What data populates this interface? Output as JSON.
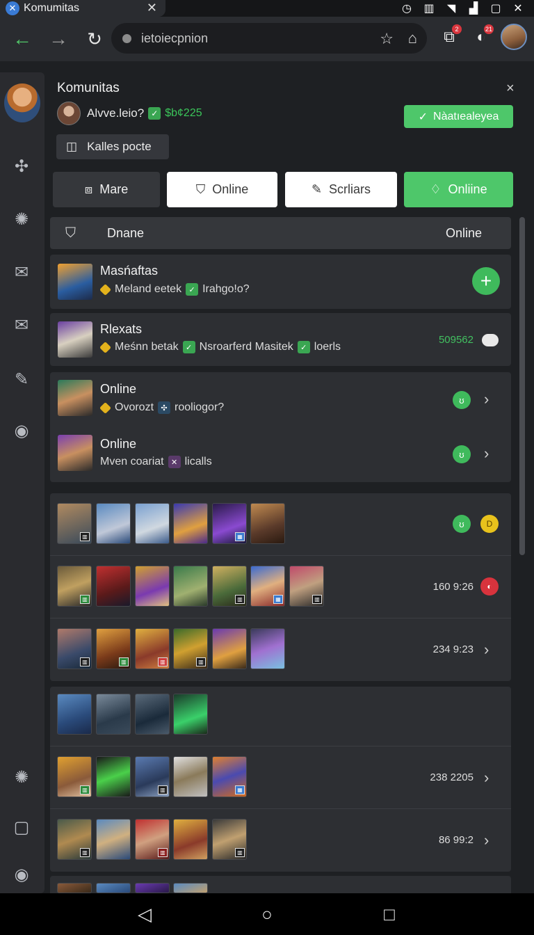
{
  "tab": {
    "title": "Komumitas",
    "close": "✕",
    "favicon": "x-icon"
  },
  "toolbar": {
    "url": "ietoiecpnion",
    "notif_badge_1": "2",
    "notif_badge_2": "21"
  },
  "panel": {
    "title": "Komunitas",
    "close": "×",
    "user": {
      "name": "Alvve.leio?",
      "points": "$b¢225"
    },
    "cta_label": "Nàatıealeyea",
    "small_button_label": "Kalles pocte"
  },
  "filter_tabs": [
    {
      "label": "Mare"
    },
    {
      "label": "Online"
    },
    {
      "label": "Scrliars"
    },
    {
      "label": "Onliine"
    }
  ],
  "list_header": {
    "name": "Dnane",
    "status": "Online"
  },
  "friends": [
    {
      "name": "Masńaftas",
      "tag1": "Meland eetek",
      "tag2": "Irahgo!o?"
    },
    {
      "name": "Rlexats",
      "tag1": "Meśnn betak",
      "tag2": "Nsroarferd Masitek",
      "tag3": "loerls",
      "number": "509562"
    }
  ],
  "online": [
    {
      "name": "Online",
      "tag1": "Ovorozt",
      "tag2": "rooliogor?",
      "badge": "ʊ"
    },
    {
      "name": "Online",
      "tag1": "Mven coariat",
      "tag2": "licalls",
      "badge": "ʊ"
    }
  ],
  "gallery_a": [
    {
      "meta": "",
      "count": 6
    },
    {
      "meta": "160  9:26",
      "count": 7
    },
    {
      "meta": "234  9:23",
      "count": 6
    }
  ],
  "gallery_b": [
    {
      "meta": "",
      "count": 4
    },
    {
      "meta": "238  2205",
      "count": 5
    },
    {
      "meta": "86  99:2",
      "count": 5
    }
  ],
  "colors": {
    "accent_green": "#4ec76a",
    "background": "#1e2023",
    "card": "#2d2f33",
    "red": "#d8333d",
    "yellow": "#e8c21c"
  },
  "icons": {
    "back": "arrow-left-icon",
    "forward": "arrow-right-icon",
    "reload": "reload-icon",
    "star": "star-icon",
    "home": "home-icon",
    "profile": "user-icon",
    "rail": [
      "puzzle-icon",
      "gear-icon",
      "mail-open-icon",
      "mail-icon",
      "tag-icon",
      "clock-icon",
      "settings-icon",
      "square-icon",
      "circle-icon"
    ]
  }
}
